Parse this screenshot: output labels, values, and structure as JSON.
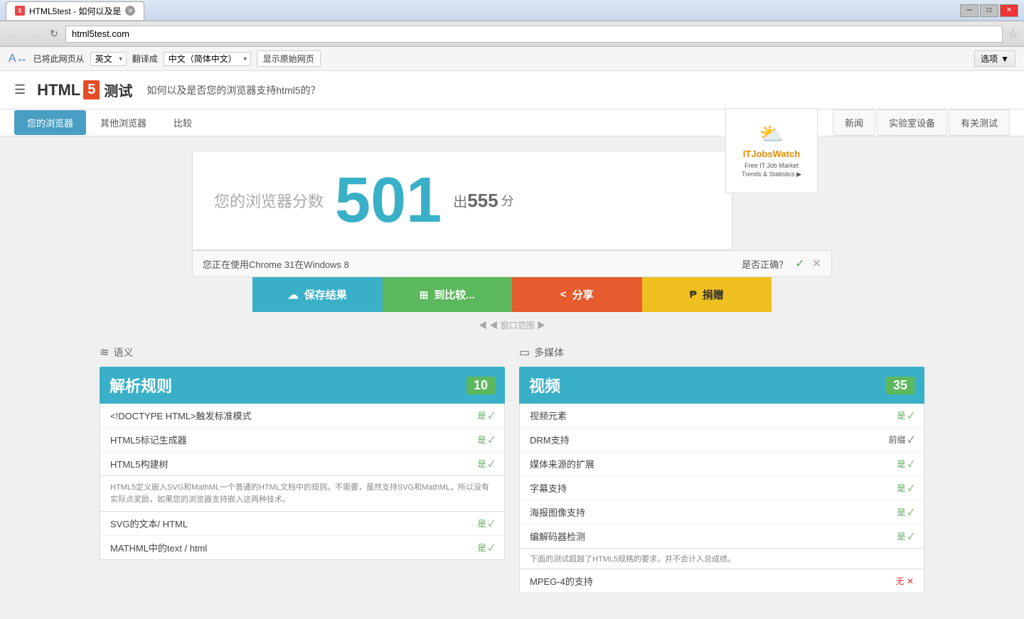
{
  "browser": {
    "tab_label": "HTML5test - 如何以及是",
    "tab_favicon": "5",
    "url": "html5test.com",
    "win_minimize": "─",
    "win_maximize": "□",
    "win_close": "✕"
  },
  "translate_bar": {
    "prefix": "已将此网页从",
    "from_lang": "英文",
    "middle": "翻译成",
    "to_lang": "中文（简体中文）",
    "show_original": "显示原始网页",
    "options": "选项"
  },
  "site": {
    "html_text": "HTML",
    "badge": "5",
    "test_label": "测试",
    "tagline": "如何以及是否您的浏览器支持html5的？"
  },
  "nav": {
    "tabs_left": [
      "您的浏览器",
      "其他浏览器",
      "比较"
    ],
    "active_tab": 0,
    "tabs_right": [
      "新闻",
      "实验室设备",
      "有关测试"
    ]
  },
  "score": {
    "label": "您的浏览器分数",
    "number": "501",
    "out_text": "出",
    "max": "555",
    "suffix": "分"
  },
  "ad": {
    "title": "ITJobsWatch",
    "subtitle": "Free IT Job Market\nTrends & Statistics"
  },
  "sys_info": {
    "text": "您正在使用Chrome 31在Windows 8",
    "correct_label": "是否正确？"
  },
  "actions": [
    {
      "icon": "☁",
      "label": "保存结果",
      "class": "btn-save"
    },
    {
      "icon": "⊞",
      "label": "到比较...",
      "class": "btn-compare"
    },
    {
      "icon": "⟨⟩",
      "label": "分享",
      "class": "btn-share"
    },
    {
      "icon": "₱",
      "label": "捐赠",
      "class": "btn-donate"
    }
  ],
  "scroll_hint": "◀ 窗口范围 ▶",
  "sections": [
    {
      "col_label": "语义",
      "col_icon": "≋",
      "blocks": [
        {
          "title": "解析规则",
          "score": "10",
          "items": [
            {
              "label": "<!DOCTYPE HTML>触发标准模式",
              "status": "是",
              "type": "yes"
            },
            {
              "label": "HTML5标记生成器",
              "status": "是",
              "type": "yes"
            },
            {
              "label": "HTML5构建树",
              "status": "是",
              "type": "yes"
            }
          ],
          "note": "HTML5定义嵌入SVG和MathML一个普通的HTML文档中的规则。不需要，虽然支持SVG和MathML，所以没有实际点奖励，如果您的浏览器支持嵌入这两种技术。",
          "extra_items": [
            {
              "label": "SVG的文本/ HTML",
              "status": "是",
              "type": "yes"
            },
            {
              "label": "MATHML中的text / html",
              "status": "是",
              "type": "yes"
            }
          ]
        }
      ]
    },
    {
      "col_label": "多媒体",
      "col_icon": "▭",
      "blocks": [
        {
          "title": "视频",
          "score": "35",
          "items": [
            {
              "label": "视频元素",
              "status": "是",
              "type": "yes"
            },
            {
              "label": "DRM支持",
              "status": "前缀",
              "type": "partial"
            },
            {
              "label": "媒体来源的扩展",
              "status": "是",
              "type": "yes"
            },
            {
              "label": "字幕支持",
              "status": "是",
              "type": "yes"
            },
            {
              "label": "海报图像支持",
              "status": "是",
              "type": "yes"
            },
            {
              "label": "编解码器检测",
              "status": "是",
              "type": "yes"
            }
          ],
          "extra_note": "下面的测试超越了HTML5规格的要求，并不会计入总成绩。",
          "extra_items": [
            {
              "label": "MPEG-4的支持",
              "status": "无",
              "type": "no"
            }
          ]
        }
      ]
    }
  ]
}
